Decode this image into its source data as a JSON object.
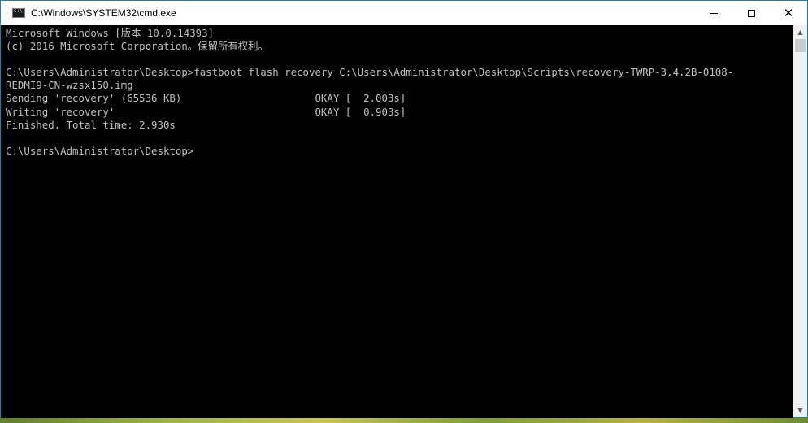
{
  "window": {
    "title": "C:\\Windows\\SYSTEM32\\cmd.exe",
    "icon": "cmd-icon"
  },
  "controls": {
    "minimize_icon": "minimize-icon",
    "maximize_icon": "maximize-icon",
    "close_icon": "close-icon"
  },
  "console": {
    "lines": [
      "Microsoft Windows [版本 10.0.14393]",
      "(c) 2016 Microsoft Corporation。保留所有权利。",
      "",
      "C:\\Users\\Administrator\\Desktop>fastboot flash recovery C:\\Users\\Administrator\\Desktop\\Scripts\\recovery-TWRP-3.4.2B-0108-",
      "REDMI9-CN-wzsx150.img",
      "Sending 'recovery' (65536 KB)                      OKAY [  2.003s]",
      "Writing 'recovery'                                 OKAY [  0.903s]",
      "Finished. Total time: 2.930s",
      "",
      "C:\\Users\\Administrator\\Desktop>"
    ]
  },
  "scrollbar": {
    "up_icon": "scroll-up-arrow-icon",
    "down_icon": "scroll-down-arrow-icon"
  },
  "colors": {
    "console_bg": "#000000",
    "console_text": "#c0c0c0",
    "window_border": "#1a7fbf"
  }
}
